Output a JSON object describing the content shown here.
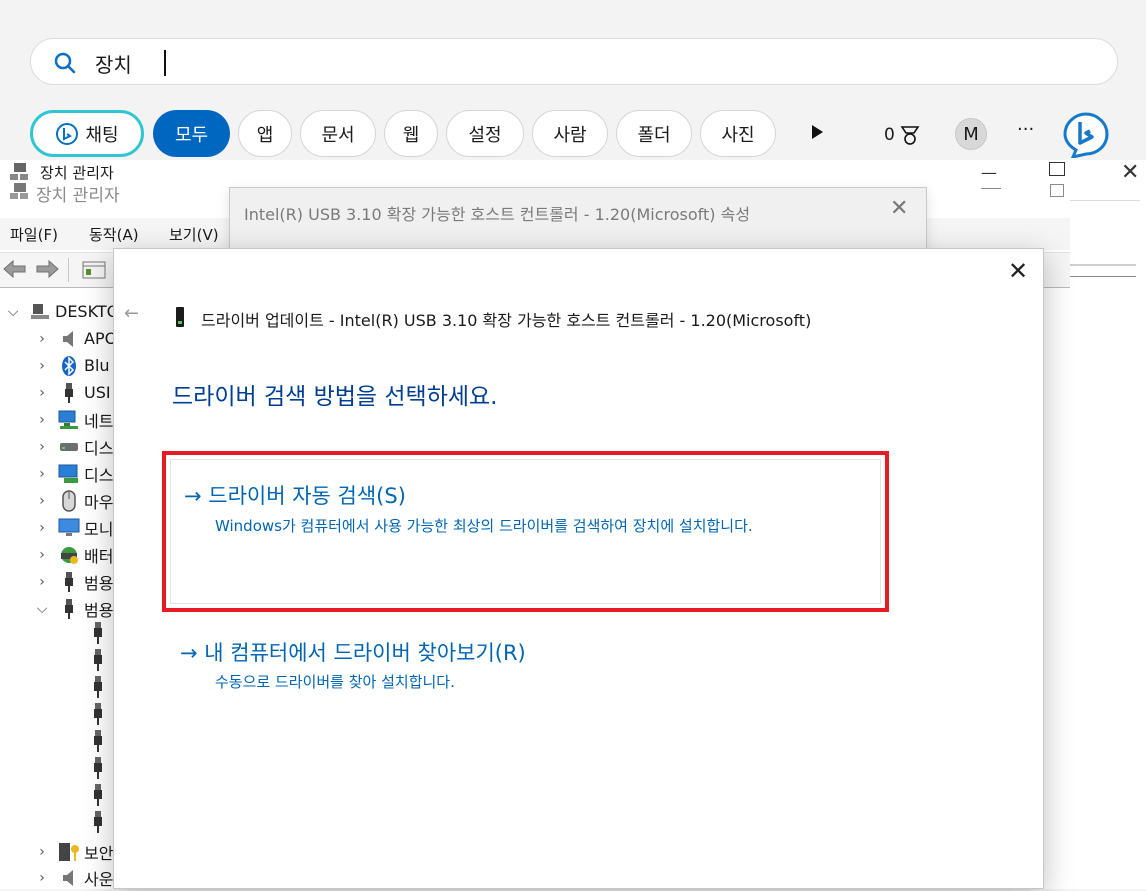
{
  "search": {
    "query": "장치"
  },
  "chips": [
    {
      "label": "채팅"
    },
    {
      "label": "모두"
    },
    {
      "label": "앱"
    },
    {
      "label": "문서"
    },
    {
      "label": "웹"
    },
    {
      "label": "설정"
    },
    {
      "label": "사람"
    },
    {
      "label": "폴더"
    },
    {
      "label": "사진"
    }
  ],
  "toolbar_right": {
    "points": "0",
    "avatar_initial": "M",
    "more": "···"
  },
  "devmgr": {
    "title_top": "장치 관리자",
    "title": "장치 관리자",
    "menus": [
      "파일(F)",
      "동작(A)",
      "보기(V)"
    ],
    "tree_root": "DESKTO",
    "tree_items": [
      "APO",
      "Blu",
      "USI",
      "네트",
      "디스",
      "디스",
      "마우",
      "모니",
      "배터",
      "범용",
      "범용",
      "보안",
      "사운"
    ]
  },
  "properties": {
    "title": "Intel(R) USB 3.10 확장 가능한 호스트 컨트롤러 - 1.20(Microsoft) 속성"
  },
  "wizard": {
    "title": "드라이버 업데이트 - Intel(R) USB 3.10 확장 가능한 호스트 컨트롤러 - 1.20(Microsoft)",
    "heading": "드라이버 검색 방법을 선택하세요.",
    "auto_search": {
      "title": "→ 드라이버 자동 검색(S)",
      "desc": "Windows가 컴퓨터에서 사용 가능한 최상의 드라이버를 검색하여 장치에 설치합니다."
    },
    "browse": {
      "title": "→ 내 컴퓨터에서 드라이버 찾아보기(R)",
      "desc": "수동으로 드라이버를 찾아 설치합니다."
    }
  },
  "colors": {
    "accent": "#0067c0",
    "link": "#0066b4",
    "highlight_border": "#e81b24",
    "chat_ring": "#2fc6d2"
  }
}
